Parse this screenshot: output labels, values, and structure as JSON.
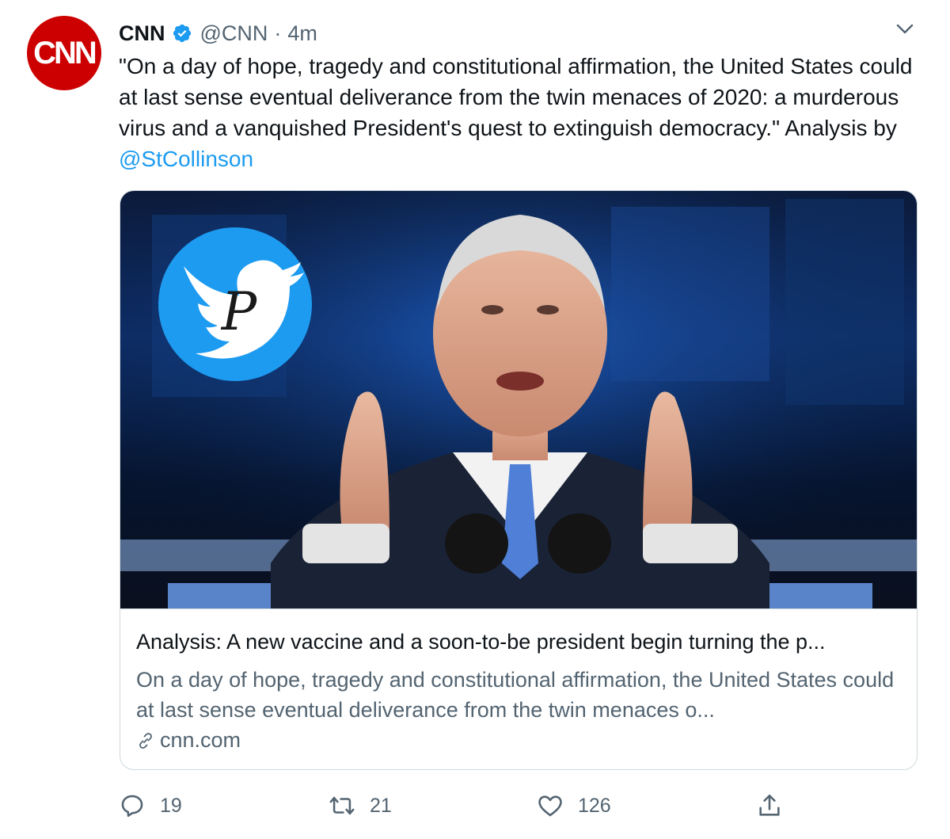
{
  "tweet": {
    "avatar_text": "CNN",
    "author_name": "CNN",
    "handle": "@CNN",
    "separator": "·",
    "timestamp": "4m",
    "text_before": "\"On a day of hope, tragedy and constitutional affirmation, the United States could at last sense eventual deliverance from the twin menaces of 2020: a murderous virus and a vanquished President's quest to extinguish democracy.\" Analysis by ",
    "mention": "@StCollinson",
    "verified_color": "#1d9bf0"
  },
  "card": {
    "watermark_letter": "P",
    "title": "Analysis: A new vaccine and a soon-to-be president begin turning the p...",
    "description": "On a day of hope, tragedy and constitutional affirmation, the United States could at last sense eventual deliverance from the twin menaces o...",
    "domain": "cnn.com"
  },
  "actions": {
    "reply_count": "19",
    "retweet_count": "21",
    "like_count": "126",
    "icons": [
      "reply-icon",
      "retweet-icon",
      "like-icon",
      "share-icon"
    ]
  },
  "colors": {
    "brand_red": "#cc0000",
    "link_blue": "#1d9bf0",
    "muted": "#536471"
  }
}
